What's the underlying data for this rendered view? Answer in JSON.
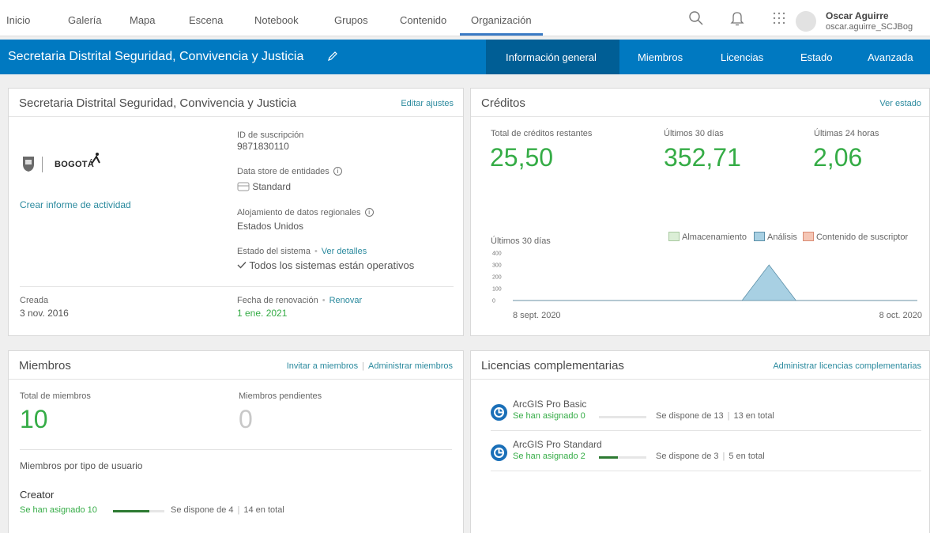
{
  "topnav": {
    "items": [
      "Inicio",
      "Galería",
      "Mapa",
      "Escena",
      "Notebook",
      "Grupos",
      "Contenido",
      "Organización"
    ],
    "active_index": 7,
    "user_name": "Oscar Aguirre",
    "user_handle": "oscar.aguirre_SCJBog"
  },
  "orgband": {
    "title": "Secretaria Distrital Seguridad, Convivencia y Justicia",
    "tabs": [
      "Información general",
      "Miembros",
      "Licencias",
      "Estado",
      "Avanzada"
    ],
    "active_tab": "Información general"
  },
  "org_card": {
    "title": "Secretaria Distrital Seguridad, Convivencia y Justicia",
    "edit_link": "Editar ajustes",
    "logo_text": "BOGOTÁ",
    "activity_link": "Crear informe de actividad",
    "subscription_label": "ID de suscripción",
    "subscription_id": "9871830110",
    "datastore_label": "Data store de entidades",
    "datastore_value": "Standard",
    "regional_label": "Alojamiento de datos regionales",
    "regional_value": "Estados Unidos",
    "system_label": "Estado del sistema",
    "system_link": "Ver detalles",
    "system_value": "Todos los sistemas están operativos",
    "created_label": "Creada",
    "created_value": "3 nov. 2016",
    "renewal_label": "Fecha de renovación",
    "renewal_link": "Renovar",
    "renewal_value": "1 ene. 2021"
  },
  "credits_card": {
    "title": "Créditos",
    "status_link": "Ver estado",
    "remaining_label": "Total de créditos restantes",
    "remaining_value": "25,50",
    "last30_label": "Últimos 30 días",
    "last30_value": "352,71",
    "last24_label": "Últimas 24 horas",
    "last24_value": "2,06",
    "chart_label": "Últimos 30 días",
    "legend": [
      {
        "name": "Almacenamiento",
        "color": "#dbeed6",
        "border": "#a9c9a0"
      },
      {
        "name": "Análisis",
        "color": "#a8d0e3",
        "border": "#5b8fa8"
      },
      {
        "name": "Contenido de suscriptor",
        "color": "#f5c6b5",
        "border": "#d98c75"
      }
    ]
  },
  "chart_data": {
    "type": "area",
    "x_labels": [
      "8 sept. 2020",
      "8 oct. 2020"
    ],
    "y_ticks": [
      0,
      100,
      200,
      300,
      400
    ],
    "ylim": [
      0,
      400
    ],
    "series": [
      {
        "name": "Análisis",
        "color": "#a8d0e3",
        "x": [
          0,
          17,
          19,
          21,
          30
        ],
        "values": [
          0,
          0,
          300,
          0,
          0
        ]
      }
    ]
  },
  "members_card": {
    "title": "Miembros",
    "invite_link": "Invitar a miembros",
    "manage_link": "Administrar miembros",
    "total_label": "Total de miembros",
    "total_value": "10",
    "pending_label": "Miembros pendientes",
    "pending_value": "0",
    "by_type_label": "Miembros por tipo de usuario",
    "type_name": "Creator",
    "type_assigned": "Se han asignado 10",
    "type_assigned_fraction": 0.71,
    "type_available": "Se dispone de 4",
    "type_total": "14 en total"
  },
  "licenses_card": {
    "title": "Licencias complementarias",
    "manage_link": "Administrar licencias complementarias",
    "items": [
      {
        "name": "ArcGIS Pro Basic",
        "assigned": "Se han asignado 0",
        "fraction": 0,
        "available": "Se dispone de 13",
        "total": "13 en total"
      },
      {
        "name": "ArcGIS Pro Standard",
        "assigned": "Se han asignado 2",
        "fraction": 0.4,
        "available": "Se dispone de 3",
        "total": "5 en total"
      }
    ]
  }
}
